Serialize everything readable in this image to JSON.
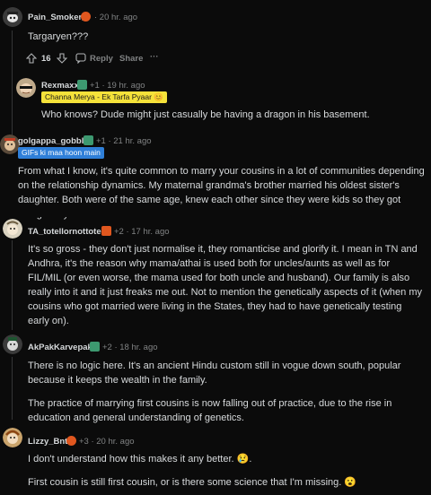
{
  "comments": [
    {
      "username": "Pain_Smoker_",
      "meta": "· 20 hr. ago",
      "body": "Targaryen???",
      "actions": {
        "votes": "16",
        "reply": "Reply",
        "share": "Share",
        "more": "···"
      }
    },
    {
      "username": "Rexmaxx",
      "meta": "+1 · 19 hr. ago",
      "flair": "Channa Merya - Ek Tarfa Pyaar 😊",
      "body": "Who knows? Dude might just casually be having a dragon in his basement."
    },
    {
      "username": "golgappa_gobbler",
      "meta": "+1 · 21 hr. ago",
      "flair": "GIFs ki maa hoon main",
      "body": "From what I know, it's quite common to marry your cousins in a lot of communities depending on the relationship dynamics. My maternal grandma's brother married his oldest sister's daughter. Both were of the same age, knew each other since they were kids so they got along really well."
    },
    {
      "username": "TA_totellornottotell",
      "meta": "+2 · 17 hr. ago",
      "body": "It's so gross - they don't just normalise it, they romanticise and glorify it. I mean in TN and Andhra, it's the reason why mama/athai is used both for uncles/aunts as well as for FIL/MIL (or even worse, the mama used for both uncle and husband). Our family is also really into it and it just freaks me out. Not to mention the genetically aspects of it (when my cousins who got married were living in the States, they had to have genetically testing early on)."
    },
    {
      "username": "AkPakKarvepak",
      "meta": "+2 · 18 hr. ago",
      "body": "There is no logic here. It's an ancient Hindu custom still in vogue down south, popular because it keeps the wealth in the family.",
      "body2": "The practice of marrying first cousins is now falling out of practice, due to the rise in education and general understanding of genetics."
    },
    {
      "username": "Lizzy_Bnt",
      "meta": "+3 · 20 hr. ago",
      "body": "I don't understand how this makes it any better. 😢.",
      "body2": "First cousin is still first cousin, or is there some science that I'm missing. 😮"
    }
  ],
  "colors": {
    "background": "#0b0b0b",
    "text": "#d7dadc",
    "muted": "#818384",
    "flair_yellow_bg": "#f5e23a",
    "flair_blue_bg": "#2f7fd8"
  }
}
